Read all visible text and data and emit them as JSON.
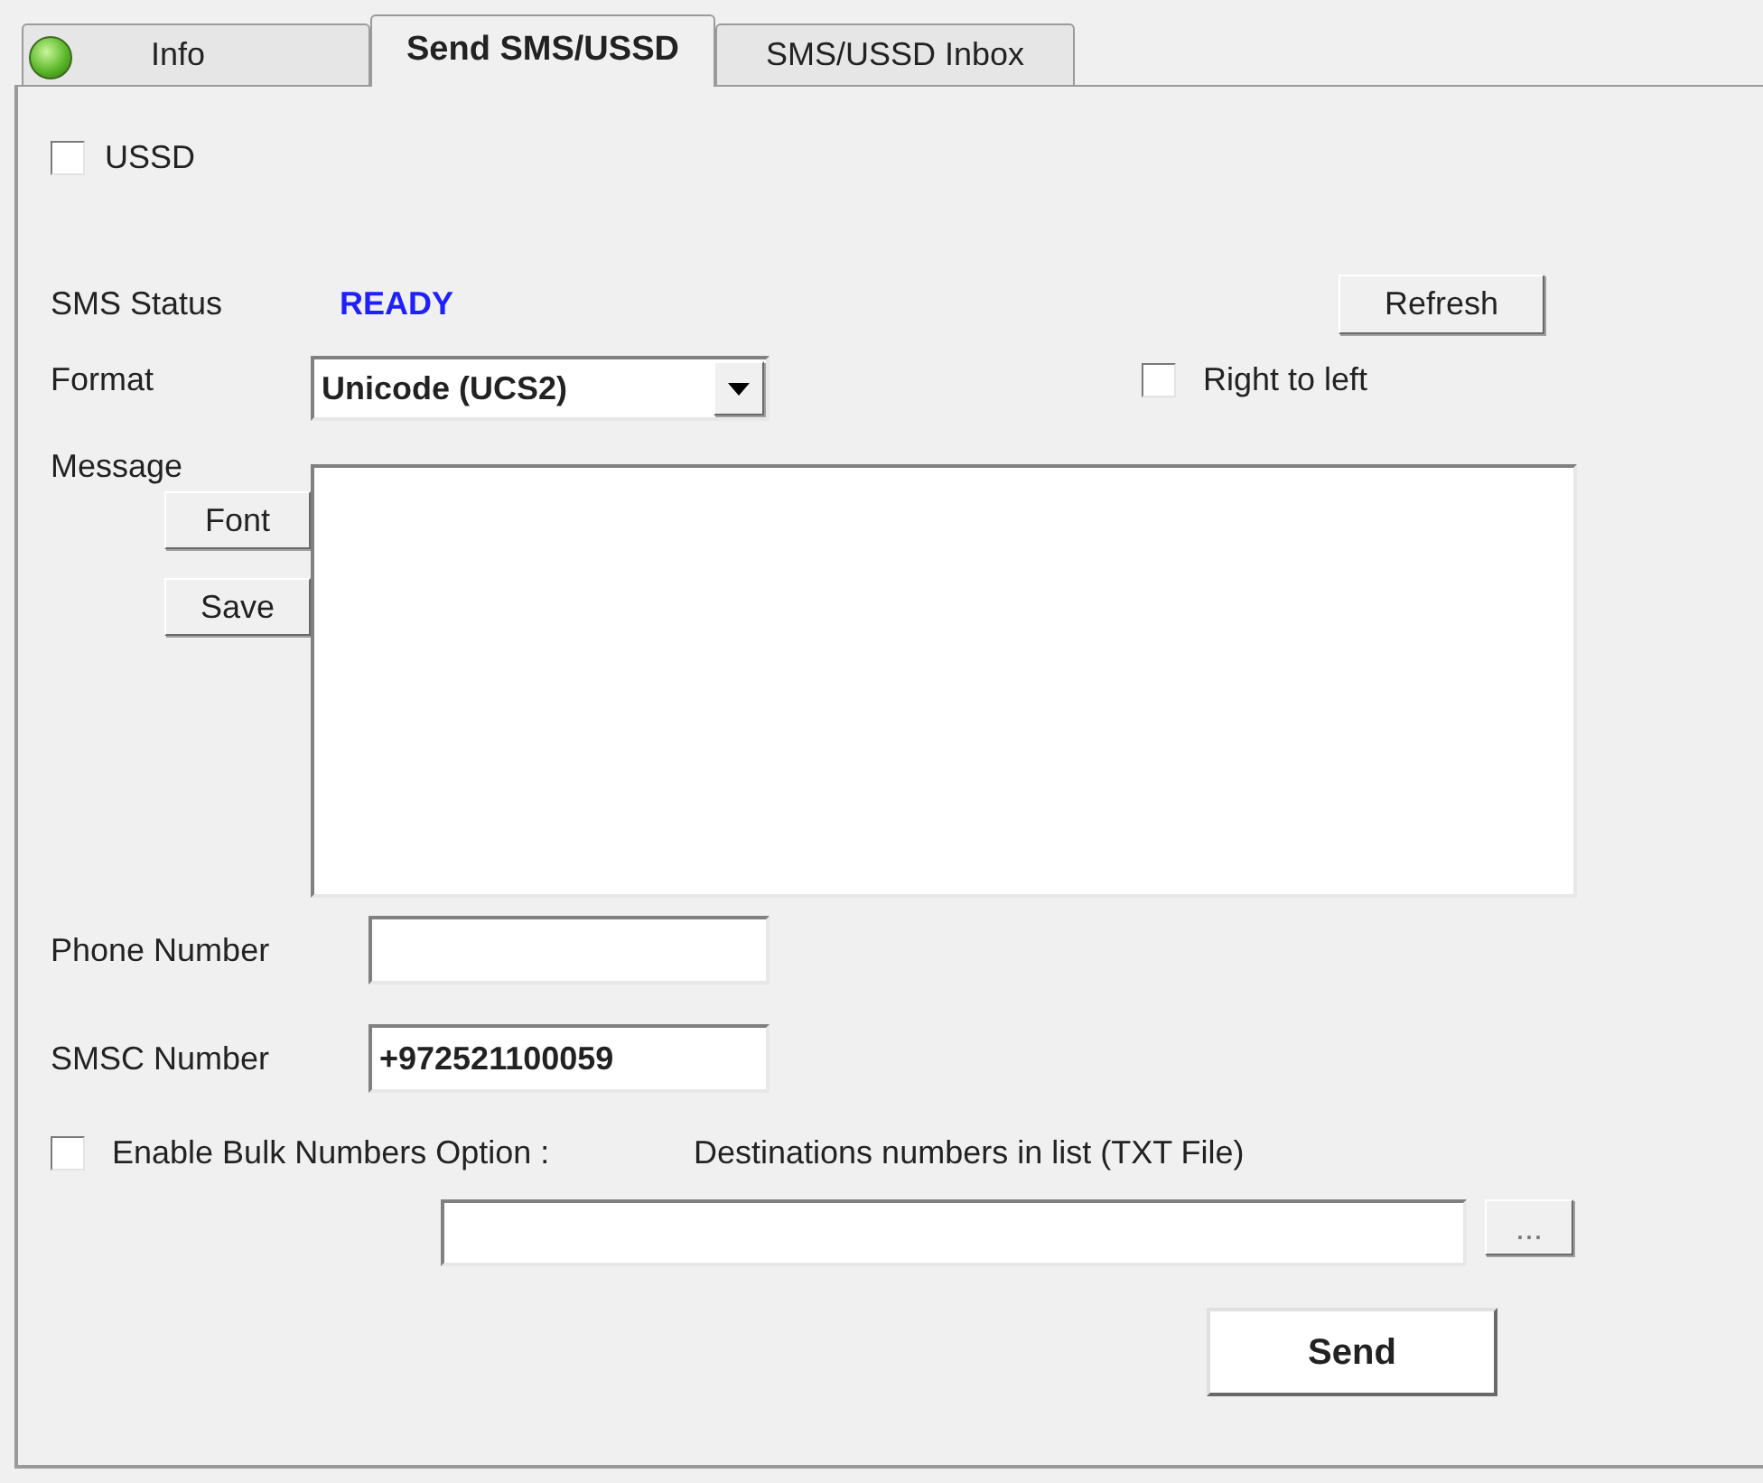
{
  "status_led": {
    "on": true
  },
  "tabs": [
    {
      "label": "Info",
      "selected": false
    },
    {
      "label": "Send SMS/USSD",
      "selected": true
    },
    {
      "label": "SMS/USSD Inbox",
      "selected": false
    }
  ],
  "ussd": {
    "label": "USSD",
    "checked": false
  },
  "sms_status": {
    "label": "SMS Status",
    "value": "READY"
  },
  "refresh_button": "Refresh",
  "format": {
    "label": "Format",
    "value": "Unicode (UCS2)"
  },
  "right_to_left": {
    "label": "Right to left",
    "checked": false
  },
  "message": {
    "label": "Message",
    "buttons": [
      "Font",
      "Save"
    ]
  },
  "phone_number": {
    "label": "Phone Number"
  },
  "smsc_number": {
    "label": "SMSC Number",
    "value": "+972521100059"
  },
  "bulk": {
    "label": "Enable Bulk Numbers Option :",
    "checked": false,
    "file_label": "Destinations numbers in list (TXT File)",
    "browse_button": "..."
  },
  "send_button": "Send"
}
